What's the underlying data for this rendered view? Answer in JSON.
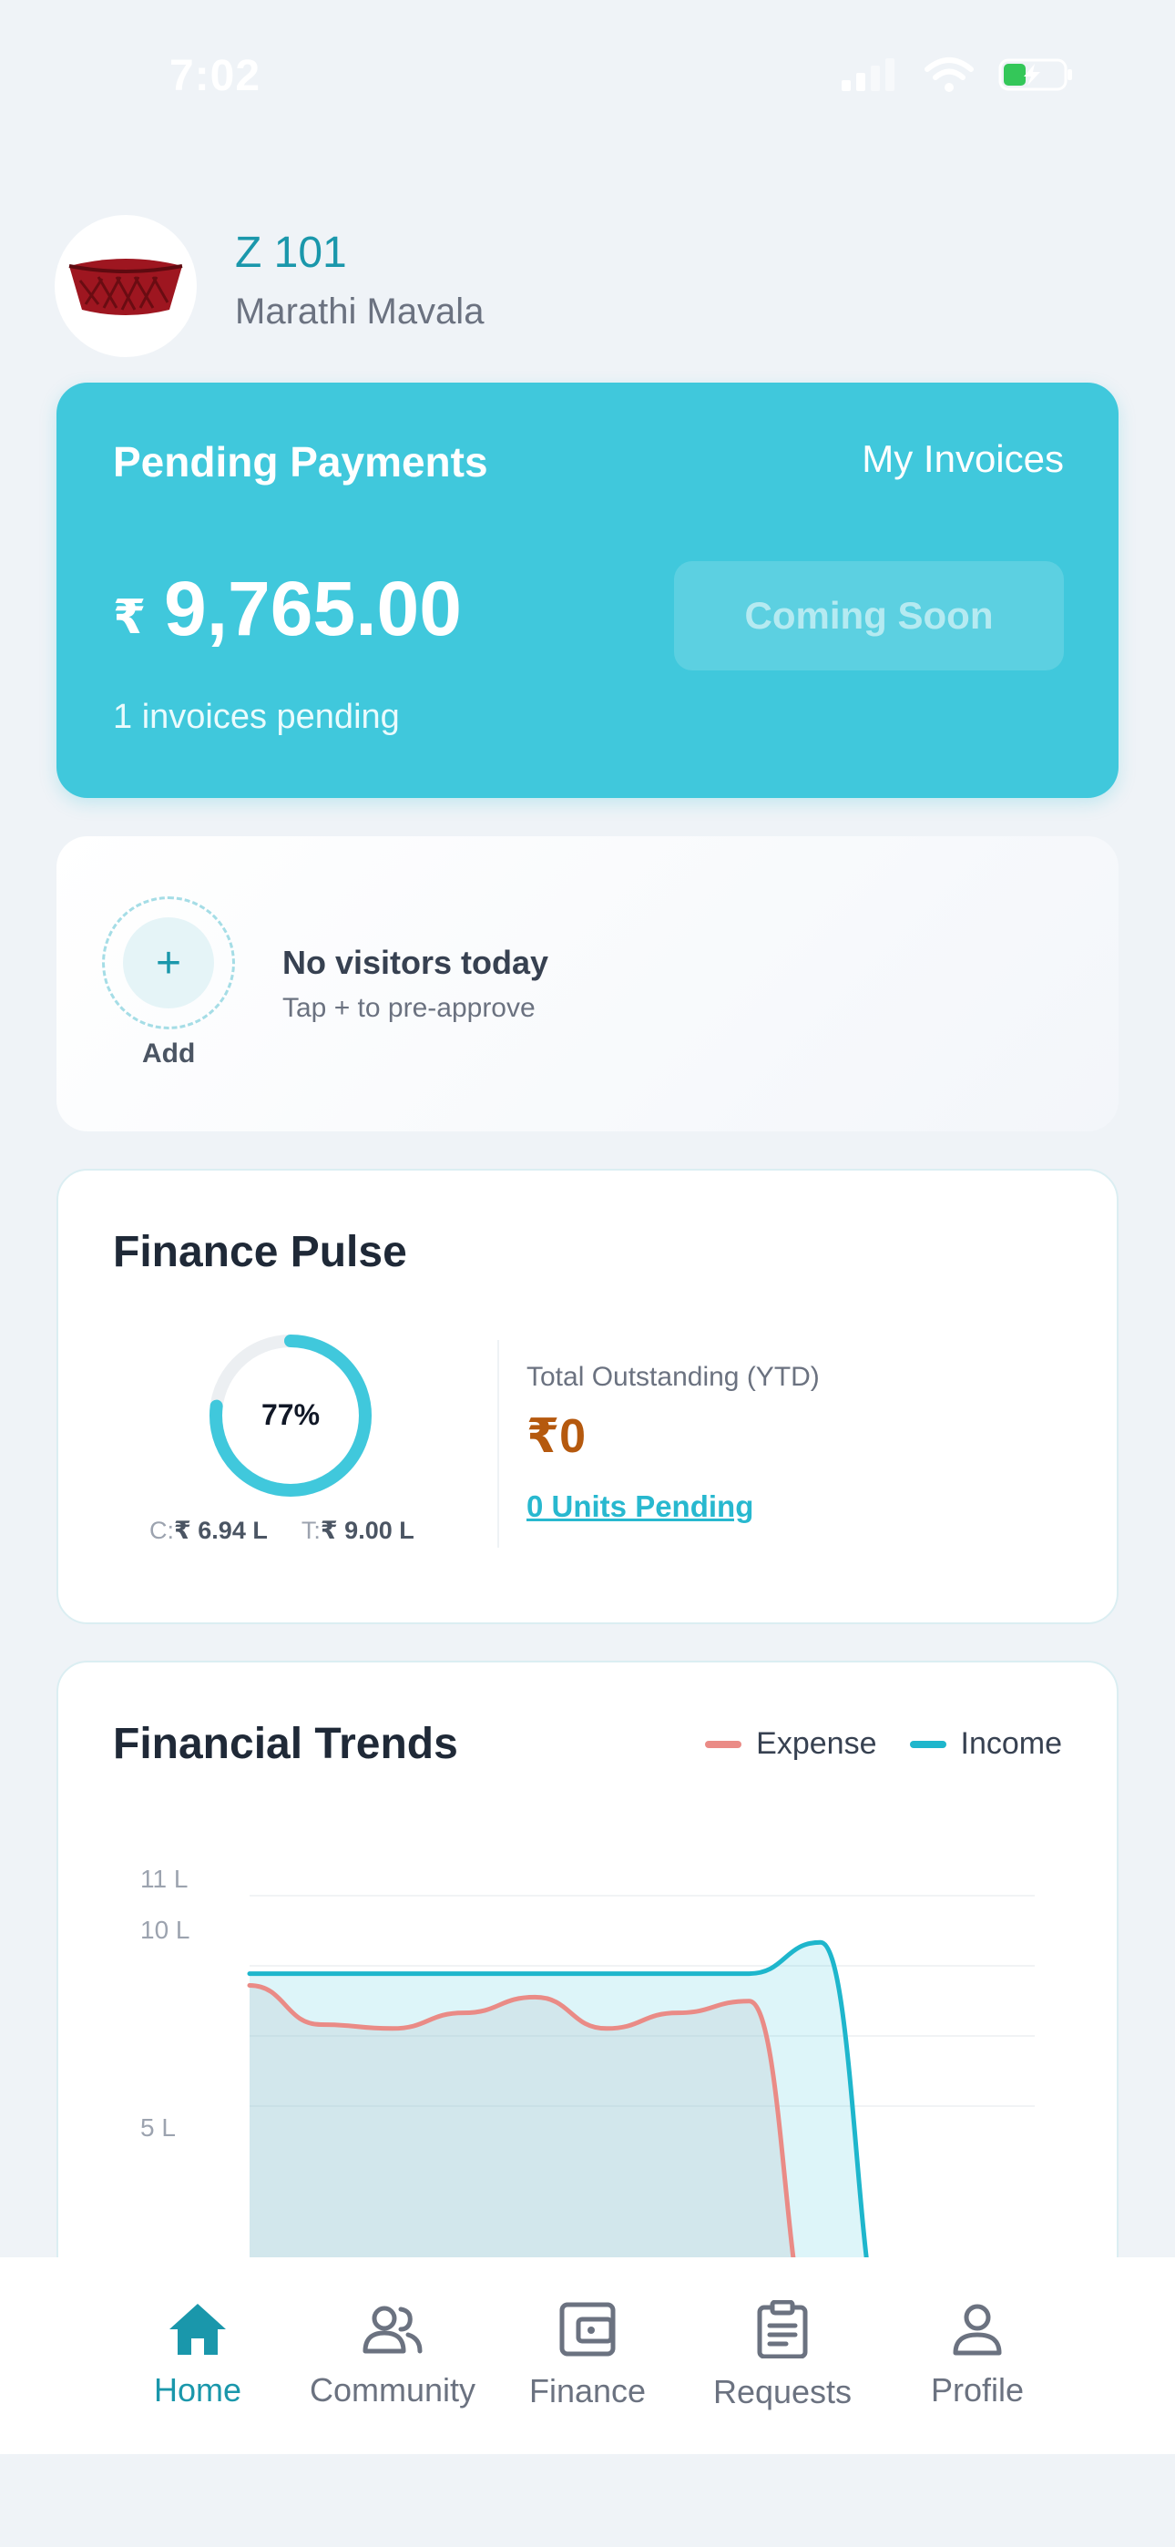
{
  "status_bar": {
    "time": "7:02"
  },
  "header": {
    "unit": "Z 101",
    "society": "Marathi Mavala"
  },
  "payments": {
    "title": "Pending Payments",
    "invoices_link": "My Invoices",
    "currency": "₹",
    "amount": "9,765.00",
    "pending_text": "1 invoices pending",
    "coming_soon": "Coming Soon"
  },
  "visitors": {
    "add_label": "Add",
    "title": "No visitors today",
    "subtitle": "Tap + to pre-approve"
  },
  "pulse": {
    "title": "Finance Pulse",
    "percent_text": "77%",
    "percent": 77,
    "collected_label": "C:",
    "collected_value": "₹ 6.94 L",
    "total_label": "T:",
    "total_value": "₹ 9.00 L",
    "outstanding_label": "Total Outstanding (YTD)",
    "outstanding_value": "₹0",
    "units_pending": "0 Units Pending"
  },
  "trends": {
    "title": "Financial Trends",
    "legend_expense": "Expense",
    "legend_income": "Income",
    "tick_11": "11 L",
    "tick_10": "10 L",
    "tick_5": "5 L"
  },
  "chart_data": {
    "type": "area",
    "x": [
      0,
      1,
      2,
      3,
      4,
      5,
      6,
      7,
      8,
      9,
      10,
      11
    ],
    "yunit": "L",
    "ylim": [
      0,
      11
    ],
    "yticks": [
      "11 L",
      "10 L",
      "5 L"
    ],
    "series": [
      {
        "name": "Income",
        "color": "#1eb6cc",
        "values": [
          9.8,
          9.8,
          9.8,
          9.8,
          9.8,
          9.8,
          9.8,
          9.8,
          10.6,
          0,
          0,
          0
        ]
      },
      {
        "name": "Expense",
        "color": "#ea8b86",
        "values": [
          9.5,
          8.5,
          8.4,
          8.8,
          9.2,
          8.4,
          8.8,
          9.1,
          0,
          0,
          0,
          0
        ]
      }
    ]
  },
  "nav": {
    "home": "Home",
    "community": "Community",
    "finance": "Finance",
    "requests": "Requests",
    "profile": "Profile"
  },
  "colors": {
    "accent": "#1a97ab",
    "card_teal": "#40c8dc",
    "expense": "#ea8b86",
    "income": "#1eb6cc",
    "outstanding": "#b5590e"
  }
}
